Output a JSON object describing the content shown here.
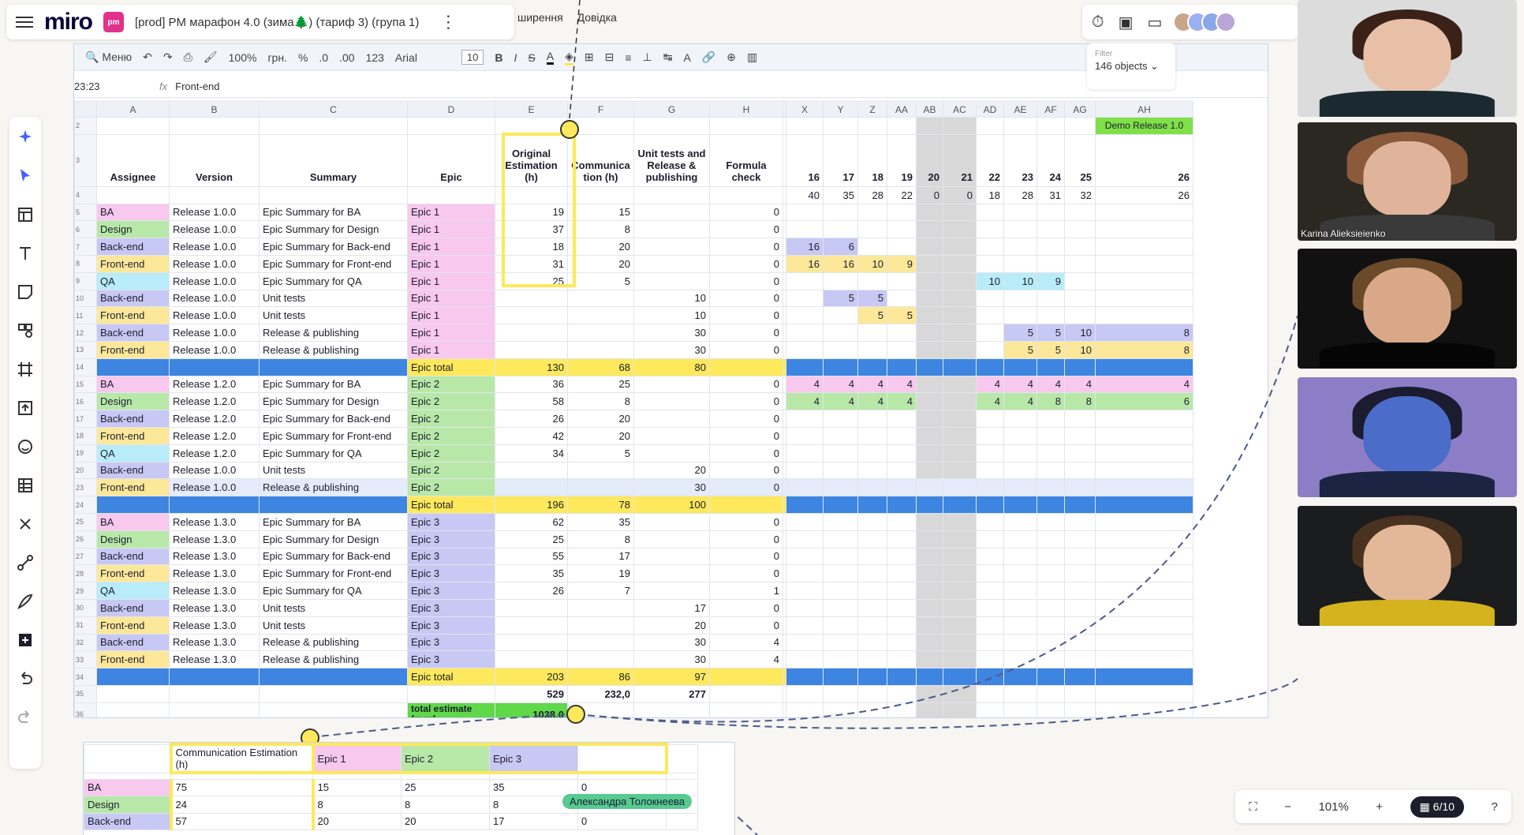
{
  "app": {
    "logo": "miro",
    "board_badge": "pm",
    "board_name": "[prod] PM марафон 4.0 (зима🌲) (тариф 3) (група 1)",
    "kebab": "⋮",
    "sheet_menu": [
      "ширення",
      "Довідка"
    ]
  },
  "collab": {
    "timer_icon": "⏱",
    "present_icon": "▣",
    "video_icon": "▭"
  },
  "toolbar": {
    "search_label": "Меню",
    "zoom": "100%",
    "currency": "грн.",
    "percent": "%",
    "dec_minus": ".0",
    "dec_plus": ".00",
    "num_fmt": "123",
    "font": "Arial",
    "size": "10",
    "bold": "B",
    "italic": "I"
  },
  "formula": {
    "ref": "23:23",
    "fx": "fx",
    "value": "Front-end"
  },
  "filter": {
    "label": "Filter",
    "count": "146 objects"
  },
  "columns_left": [
    "A",
    "B",
    "C",
    "D",
    "E",
    "F",
    "G",
    "H"
  ],
  "columns_right": [
    "X",
    "Y",
    "Z",
    "AA",
    "AB",
    "AC",
    "AD",
    "AE",
    "AF",
    "AG",
    "AH"
  ],
  "header_row": {
    "assignee": "Assignee",
    "version": "Version",
    "summary": "Summary",
    "epic": "Epic",
    "orig": "Original Estimation (h)",
    "comm": "Communica tion (h)",
    "unit": "Unit tests and Release & publishing",
    "formula": "Formula check",
    "demo": "Demo Release 1.0",
    "weeks": [
      "16",
      "17",
      "18",
      "19",
      "20",
      "21",
      "22",
      "23",
      "24",
      "25",
      "26"
    ],
    "cap": [
      "40",
      "35",
      "28",
      "22",
      "0",
      "0",
      "18",
      "28",
      "31",
      "32",
      "26"
    ]
  },
  "rows": [
    {
      "n": "5",
      "a": "BA",
      "b": "Release 1.0.0",
      "c": "Epic Summary for  BA",
      "d": "Epic 1",
      "e": "19",
      "f": "15",
      "g": "",
      "h": "0",
      "r": [
        "",
        "",
        "",
        "",
        "",
        "",
        "",
        "",
        "",
        "",
        ""
      ]
    },
    {
      "n": "6",
      "a": "Design",
      "b": "Release 1.0.0",
      "c": "Epic Summary for Design",
      "d": "Epic 1",
      "e": "37",
      "f": "8",
      "g": "",
      "h": "0",
      "r": [
        "",
        "",
        "",
        "",
        "",
        "",
        "",
        "",
        "",
        "",
        ""
      ]
    },
    {
      "n": "7",
      "a": "Back-end",
      "b": "Release 1.0.0",
      "c": "Epic Summary for  Back-end",
      "d": "Epic 1",
      "e": "18",
      "f": "20",
      "g": "",
      "h": "0",
      "r": [
        "16",
        "6",
        "",
        "",
        "",
        "",
        "",
        "",
        "",
        "",
        ""
      ]
    },
    {
      "n": "8",
      "a": "Front-end",
      "b": "Release 1.0.0",
      "c": "Epic Summary for Front-end",
      "d": "Epic 1",
      "e": "31",
      "f": "20",
      "g": "",
      "h": "0",
      "r": [
        "16",
        "16",
        "10",
        "9",
        "",
        "",
        "",
        "",
        "",
        "",
        ""
      ]
    },
    {
      "n": "9",
      "a": "QA",
      "b": "Release 1.0.0",
      "c": "Epic Summary for QA",
      "d": "Epic 1",
      "e": "25",
      "f": "5",
      "g": "",
      "h": "0",
      "r": [
        "",
        "",
        "",
        "",
        "",
        "",
        "10",
        "10",
        "9",
        "",
        ""
      ]
    },
    {
      "n": "10",
      "a": "Back-end",
      "b": "Release 1.0.0",
      "c": "Unit tests",
      "d": "Epic 1",
      "e": "",
      "f": "",
      "g": "10",
      "h": "0",
      "r": [
        "",
        "5",
        "5",
        "",
        "",
        "",
        "",
        "",
        "",
        "",
        ""
      ]
    },
    {
      "n": "11",
      "a": "Front-end",
      "b": "Release 1.0.0",
      "c": "Unit tests",
      "d": "Epic 1",
      "e": "",
      "f": "",
      "g": "10",
      "h": "0",
      "r": [
        "",
        "",
        "5",
        "5",
        "",
        "",
        "",
        "",
        "",
        "",
        ""
      ]
    },
    {
      "n": "12",
      "a": "Back-end",
      "b": "Release 1.0.0",
      "c": "Release & publishing",
      "d": "Epic 1",
      "e": "",
      "f": "",
      "g": "30",
      "h": "0",
      "r": [
        "",
        "",
        "",
        "",
        "",
        "",
        "",
        "5",
        "5",
        "10",
        "8"
      ]
    },
    {
      "n": "13",
      "a": "Front-end",
      "b": "Release 1.0.0",
      "c": "Release & publishing",
      "d": "Epic 1",
      "e": "",
      "f": "",
      "g": "30",
      "h": "0",
      "r": [
        "",
        "",
        "",
        "",
        "",
        "",
        "",
        "5",
        "5",
        "10",
        "8"
      ]
    },
    {
      "n": "14",
      "total": true,
      "d": "Epic total",
      "e": "130",
      "f": "68",
      "g": "80"
    },
    {
      "n": "15",
      "a": "BA",
      "b": "Release 1.2.0",
      "c": "Epic Summary for  BA",
      "d": "Epic 2",
      "e": "36",
      "f": "25",
      "g": "",
      "h": "0",
      "r": [
        "4",
        "4",
        "4",
        "4",
        "",
        "",
        "4",
        "4",
        "4",
        "4",
        "4"
      ]
    },
    {
      "n": "16",
      "a": "Design",
      "b": "Release 1.2.0",
      "c": "Epic Summary for Design",
      "d": "Epic 2",
      "e": "58",
      "f": "8",
      "g": "",
      "h": "0",
      "r": [
        "4",
        "4",
        "4",
        "4",
        "",
        "",
        "4",
        "4",
        "8",
        "8",
        "6"
      ]
    },
    {
      "n": "17",
      "a": "Back-end",
      "b": "Release 1.2.0",
      "c": "Epic Summary for  Back-end",
      "d": "Epic 2",
      "e": "26",
      "f": "20",
      "g": "",
      "h": "0",
      "r": [
        "",
        "",
        "",
        "",
        "",
        "",
        "",
        "",
        "",
        "",
        ""
      ]
    },
    {
      "n": "18",
      "a": "Front-end",
      "b": "Release 1.2.0",
      "c": "Epic Summary for Front-end",
      "d": "Epic 2",
      "e": "42",
      "f": "20",
      "g": "",
      "h": "0",
      "r": [
        "",
        "",
        "",
        "",
        "",
        "",
        "",
        "",
        "",
        "",
        ""
      ]
    },
    {
      "n": "19",
      "a": "QA",
      "b": "Release 1.2.0",
      "c": "Epic Summary for QA",
      "d": "Epic 2",
      "e": "34",
      "f": "5",
      "g": "",
      "h": "0",
      "r": [
        "",
        "",
        "",
        "",
        "",
        "",
        "",
        "",
        "",
        "",
        ""
      ]
    },
    {
      "n": "20",
      "a": "Back-end",
      "b": "Release 1.0.0",
      "c": "Unit tests",
      "d": "Epic 2",
      "e": "",
      "f": "",
      "g": "20",
      "h": "0",
      "r": [
        "",
        "",
        "",
        "",
        "",
        "",
        "",
        "",
        "",
        "",
        ""
      ]
    },
    {
      "n": "23",
      "a": "Front-end",
      "b": "Release 1.0.0",
      "c": "Release & publishing",
      "d": "Epic 2",
      "e": "",
      "f": "",
      "g": "30",
      "h": "0",
      "sel": true,
      "r": [
        "",
        "",
        "",
        "",
        "",
        "",
        "",
        "",
        "",
        "",
        ""
      ]
    },
    {
      "n": "24",
      "total": true,
      "d": "Epic total",
      "e": "196",
      "f": "78",
      "g": "100"
    },
    {
      "n": "25",
      "a": "BA",
      "b": "Release 1.3.0",
      "c": "Epic Summary for  BA",
      "d": "Epic 3",
      "e": "62",
      "f": "35",
      "g": "",
      "h": "0",
      "r": [
        "",
        "",
        "",
        "",
        "",
        "",
        "",
        "",
        "",
        "",
        ""
      ]
    },
    {
      "n": "26",
      "a": "Design",
      "b": "Release 1.3.0",
      "c": "Epic Summary for Design",
      "d": "Epic 3",
      "e": "25",
      "f": "8",
      "g": "",
      "h": "0",
      "r": [
        "",
        "",
        "",
        "",
        "",
        "",
        "",
        "",
        "",
        "",
        ""
      ]
    },
    {
      "n": "27",
      "a": "Back-end",
      "b": "Release 1.3.0",
      "c": "Epic Summary for  Back-end",
      "d": "Epic 3",
      "e": "55",
      "f": "17",
      "g": "",
      "h": "0",
      "r": [
        "",
        "",
        "",
        "",
        "",
        "",
        "",
        "",
        "",
        "",
        ""
      ]
    },
    {
      "n": "28",
      "a": "Front-end",
      "b": "Release 1.3.0",
      "c": "Epic Summary for Front-end",
      "d": "Epic 3",
      "e": "35",
      "f": "19",
      "g": "",
      "h": "0",
      "r": [
        "",
        "",
        "",
        "",
        "",
        "",
        "",
        "",
        "",
        "",
        ""
      ]
    },
    {
      "n": "29",
      "a": "QA",
      "b": "Release 1.3.0",
      "c": "Epic Summary for QA",
      "d": "Epic 3",
      "e": "26",
      "f": "7",
      "g": "",
      "h": "1",
      "r": [
        "",
        "",
        "",
        "",
        "",
        "",
        "",
        "",
        "",
        "",
        ""
      ]
    },
    {
      "n": "30",
      "a": "Back-end",
      "b": "Release 1.3.0",
      "c": "Unit tests",
      "d": "Epic 3",
      "e": "",
      "f": "",
      "g": "17",
      "h": "0",
      "r": [
        "",
        "",
        "",
        "",
        "",
        "",
        "",
        "",
        "",
        "",
        ""
      ]
    },
    {
      "n": "31",
      "a": "Front-end",
      "b": "Release 1.3.0",
      "c": "Unit tests",
      "d": "Epic 3",
      "e": "",
      "f": "",
      "g": "20",
      "h": "0",
      "r": [
        "",
        "",
        "",
        "",
        "",
        "",
        "",
        "",
        "",
        "",
        ""
      ]
    },
    {
      "n": "32",
      "a": "Back-end",
      "b": "Release 1.3.0",
      "c": "Release & publishing",
      "d": "Epic 3",
      "e": "",
      "f": "",
      "g": "30",
      "h": "4",
      "r": [
        "",
        "",
        "",
        "",
        "",
        "",
        "",
        "",
        "",
        "",
        ""
      ]
    },
    {
      "n": "33",
      "a": "Front-end",
      "b": "Release 1.3.0",
      "c": "Release & publishing",
      "d": "Epic 3",
      "e": "",
      "f": "",
      "g": "30",
      "h": "4",
      "r": [
        "",
        "",
        "",
        "",
        "",
        "",
        "",
        "",
        "",
        "",
        ""
      ]
    },
    {
      "n": "34",
      "total": true,
      "d": "Epic total",
      "e": "203",
      "f": "86",
      "g": "97"
    }
  ],
  "sum_row": {
    "n": "35",
    "e": "529",
    "f": "232,0",
    "g": "277"
  },
  "total_row": {
    "n": "36",
    "label": "total estimate (max)",
    "value": "1038,0"
  },
  "rightcolors": {
    "7": [
      "pu",
      "pu",
      "",
      "",
      "",
      "",
      "",
      "",
      "",
      "",
      ""
    ],
    "8": [
      "yl",
      "yl",
      "yl",
      "yl",
      "",
      "",
      "",
      "",
      "",
      "",
      ""
    ],
    "9": [
      "",
      "",
      "",
      "",
      "",
      "",
      "cy",
      "cy",
      "cy",
      "",
      ""
    ],
    "10": [
      "",
      "pu",
      "pu",
      "",
      "",
      "",
      "",
      "",
      "",
      "",
      ""
    ],
    "11": [
      "",
      "",
      "yl",
      "yl",
      "",
      "",
      "",
      "",
      "",
      "",
      ""
    ],
    "12": [
      "",
      "",
      "",
      "",
      "",
      "",
      "",
      "pu",
      "pu",
      "pu",
      "pu"
    ],
    "13": [
      "",
      "",
      "",
      "",
      "",
      "",
      "",
      "yl",
      "yl",
      "yl",
      "yl"
    ],
    "15": [
      "pk",
      "pk",
      "pk",
      "pk",
      "",
      "",
      "pk",
      "pk",
      "pk",
      "pk",
      "pk"
    ],
    "16": [
      "gr",
      "gr",
      "gr",
      "gr",
      "",
      "",
      "gr",
      "gr",
      "gr",
      "gr",
      "gr"
    ]
  },
  "mini": {
    "header": "Communication Estimation (h)",
    "epics": [
      "Epic 1",
      "Epic 2",
      "Epic 3"
    ],
    "rows": [
      {
        "a": "BA",
        "v": "75",
        "e1": "15",
        "e2": "25",
        "e3": "35",
        "x": "0"
      },
      {
        "a": "Design",
        "v": "24",
        "e1": "8",
        "e2": "8",
        "e3": "8",
        "x": "0"
      },
      {
        "a": "Back-end",
        "v": "57",
        "e1": "20",
        "e2": "20",
        "e3": "17",
        "x": "0"
      }
    ]
  },
  "cursor_name": "Александра Толокнеева",
  "videos": [
    {
      "name": ""
    },
    {
      "name": "Karina Alieksieienko"
    },
    {
      "name": ""
    },
    {
      "name": ""
    },
    {
      "name": ""
    }
  ],
  "zoombar": {
    "fit": "⛶",
    "minus": "−",
    "zoom": "101%",
    "plus": "+",
    "pages": "6/10",
    "help": "?"
  },
  "colors": {
    "accent": "#4262ff",
    "total": "#3d85e0",
    "yellow": "#fde95b",
    "green": "#7fe04a"
  }
}
